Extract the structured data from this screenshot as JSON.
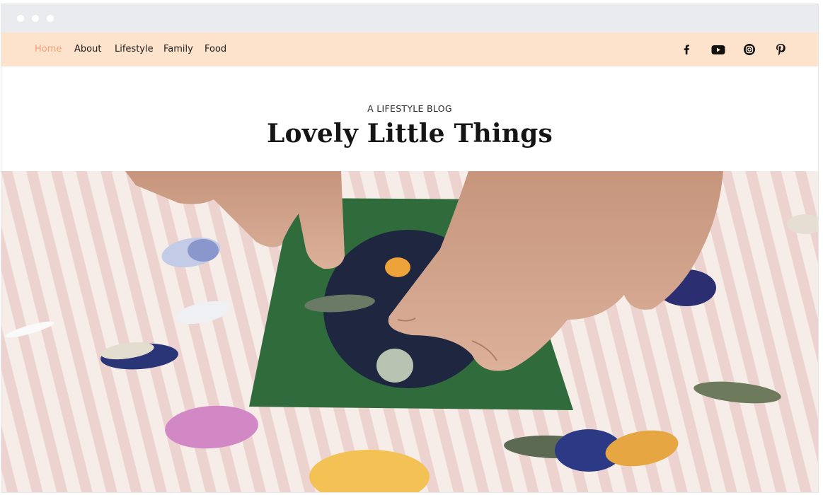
{
  "nav": {
    "items": [
      {
        "label": "Home",
        "active": true
      },
      {
        "label": "About",
        "active": false
      },
      {
        "label": "Lifestyle",
        "active": false
      },
      {
        "label": "Family",
        "active": false
      },
      {
        "label": "Food",
        "active": false
      }
    ],
    "social": [
      "facebook-icon",
      "youtube-icon",
      "instagram-icon",
      "pinterest-icon"
    ]
  },
  "header": {
    "kicker": "A LIFESTYLE BLOG",
    "title": "Lovely Little Things"
  },
  "colors": {
    "nav_background": "#fde2cc",
    "active_link": "#f0a27c",
    "text": "#1b1b1b",
    "browser_chrome": "#e9ebef"
  }
}
